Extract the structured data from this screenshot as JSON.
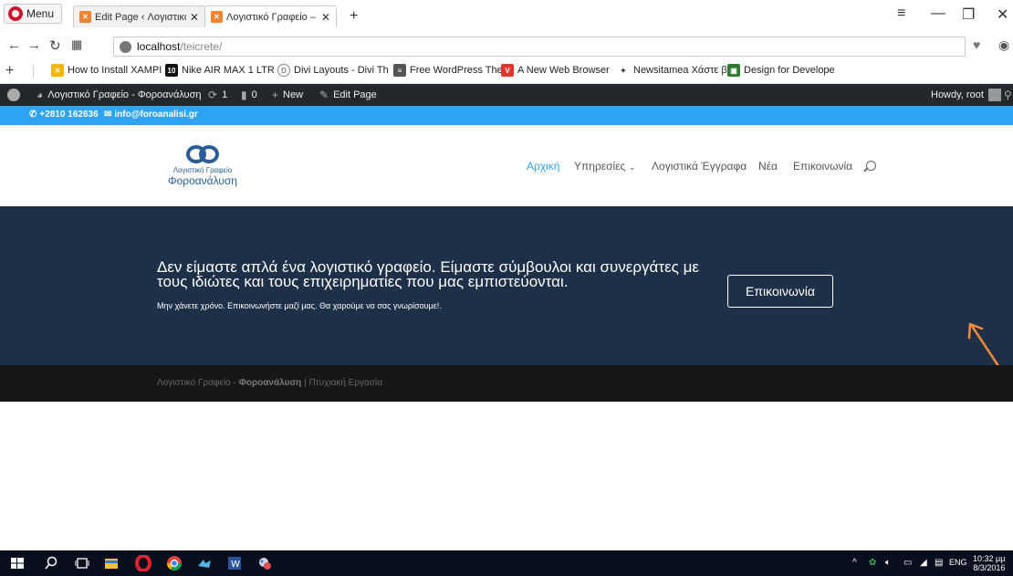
{
  "browser": {
    "menu_label": "Menu",
    "tabs": [
      {
        "title": "Edit Page ‹ Λογιστικό Γραφ",
        "favicon": "xampp-icon"
      },
      {
        "title": "Λογιστικό Γραφείο – Φορο",
        "favicon": "xampp-icon"
      }
    ],
    "url_host": "localhost",
    "url_path": "/teicrete/",
    "bookmarks": [
      {
        "label": "How to Install XAMPI",
        "icon": "xampp-icon",
        "color": "#f7b500"
      },
      {
        "label": "Nike AIR MAX 1 LTR",
        "icon": "nike-icon",
        "color": "#111111"
      },
      {
        "label": "Divi Layouts - Divi Th",
        "icon": "divi-icon",
        "color": "#888888"
      },
      {
        "label": "Free WordPress Them",
        "icon": "document-icon",
        "color": "#555555"
      },
      {
        "label": "A New Web Browser",
        "icon": "vivaldi-icon",
        "color": "#e0352b"
      },
      {
        "label": "Newsitamea Χάστε β",
        "icon": "newsitamea-icon",
        "color": "#333333"
      },
      {
        "label": "Design for Develope",
        "icon": "design-icon",
        "color": "#2c7a2c"
      }
    ]
  },
  "adminbar": {
    "site_name": "Λογιστικό Γραφείο - Φοροανάλυση",
    "updates": "1",
    "comments": "0",
    "new_label": "New",
    "edit_label": "Edit Page",
    "howdy": "Howdy, root"
  },
  "topbar": {
    "phone": "+2810 162636",
    "email": "info@foroanalisi.gr"
  },
  "header": {
    "logo_line1": "Λογιστικό Γραφείο",
    "logo_line2": "Φοροανάλυση",
    "menu": [
      "Αρχική",
      "Υπηρεσίες",
      "Λογιστικά Έγγραφα",
      "Νέα",
      "Επικοινωνία"
    ]
  },
  "cta": {
    "title": "Δεν είμαστε απλά ένα λογιστικό γραφείο. Είμαστε σύμβουλοι και συνεργάτες με τους ιδιώτες και τους επιχειρηματίες που μας εμπιστεύονται.",
    "subtitle": "Μην χάνετε χρόνο. Επικοινωνήστε μαζί μας. Θα χαρούμε να σας γνωρίσουμε!.",
    "button": "Επικοινωνία"
  },
  "footer": {
    "prefix": "Λογιστικό Γραφείο -",
    "brand": "Φοροανάλυση",
    "separator": "|",
    "suffix": "Πτυχιακή Εργασία"
  },
  "taskbar": {
    "lang": "ENG",
    "time": "10:32 μμ",
    "date": "8/3/2016"
  },
  "colors": {
    "accent": "#2ea3f2",
    "cta_bg": "#1e3048",
    "admin_bg": "#23282d",
    "arrow": "#f08a3c"
  }
}
